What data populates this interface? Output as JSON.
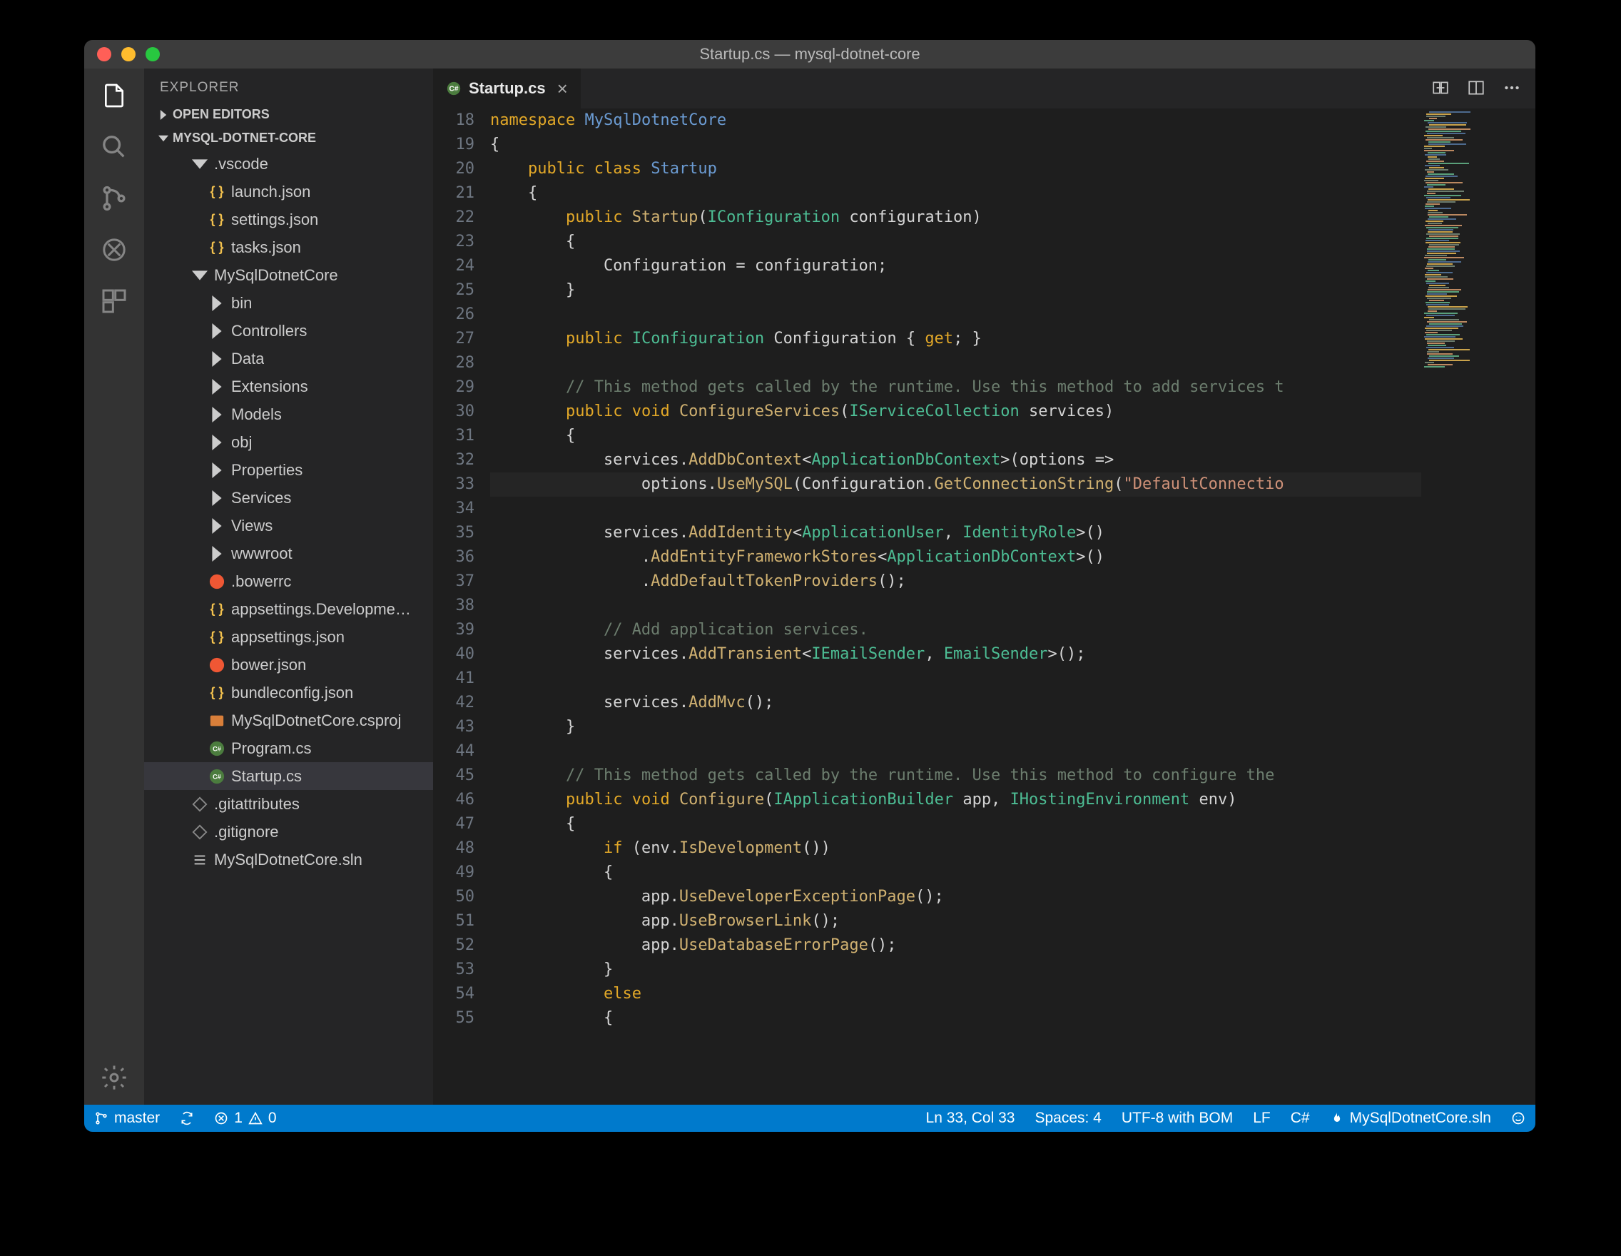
{
  "window": {
    "title": "Startup.cs — mysql-dotnet-core"
  },
  "sidebar": {
    "title": "EXPLORER",
    "open_editors": "OPEN EDITORS",
    "project": "MYSQL-DOTNET-CORE",
    "items": [
      {
        "label": ".vscode",
        "kind": "folder-open",
        "indent": 2
      },
      {
        "label": "launch.json",
        "kind": "json",
        "indent": 3
      },
      {
        "label": "settings.json",
        "kind": "json",
        "indent": 3
      },
      {
        "label": "tasks.json",
        "kind": "json",
        "indent": 3
      },
      {
        "label": "MySqlDotnetCore",
        "kind": "folder-open",
        "indent": 2
      },
      {
        "label": "bin",
        "kind": "folder",
        "indent": 3
      },
      {
        "label": "Controllers",
        "kind": "folder",
        "indent": 3
      },
      {
        "label": "Data",
        "kind": "folder",
        "indent": 3
      },
      {
        "label": "Extensions",
        "kind": "folder",
        "indent": 3
      },
      {
        "label": "Models",
        "kind": "folder",
        "indent": 3
      },
      {
        "label": "obj",
        "kind": "folder",
        "indent": 3
      },
      {
        "label": "Properties",
        "kind": "folder",
        "indent": 3
      },
      {
        "label": "Services",
        "kind": "folder",
        "indent": 3
      },
      {
        "label": "Views",
        "kind": "folder",
        "indent": 3
      },
      {
        "label": "wwwroot",
        "kind": "folder",
        "indent": 3
      },
      {
        "label": ".bowerrc",
        "kind": "bower",
        "indent": 3
      },
      {
        "label": "appsettings.Developme…",
        "kind": "json",
        "indent": 3
      },
      {
        "label": "appsettings.json",
        "kind": "json",
        "indent": 3
      },
      {
        "label": "bower.json",
        "kind": "bower",
        "indent": 3
      },
      {
        "label": "bundleconfig.json",
        "kind": "json",
        "indent": 3
      },
      {
        "label": "MySqlDotnetCore.csproj",
        "kind": "xml",
        "indent": 3
      },
      {
        "label": "Program.cs",
        "kind": "cs",
        "indent": 3
      },
      {
        "label": "Startup.cs",
        "kind": "cs",
        "indent": 3,
        "selected": true
      },
      {
        "label": ".gitattributes",
        "kind": "git",
        "indent": 2
      },
      {
        "label": ".gitignore",
        "kind": "git",
        "indent": 2
      },
      {
        "label": "MySqlDotnetCore.sln",
        "kind": "sln",
        "indent": 2
      }
    ]
  },
  "tab": {
    "label": "Startup.cs"
  },
  "gutter_start": 18,
  "code_lines": [
    [
      [
        "kw",
        "namespace"
      ],
      [
        "pun",
        " "
      ],
      [
        "type",
        "MySqlDotnetCore"
      ]
    ],
    [
      [
        "pun",
        "{"
      ]
    ],
    [
      [
        "pun",
        "    "
      ],
      [
        "kw",
        "public"
      ],
      [
        "pun",
        " "
      ],
      [
        "kw",
        "class"
      ],
      [
        "pun",
        " "
      ],
      [
        "type",
        "Startup"
      ]
    ],
    [
      [
        "pun",
        "    {"
      ]
    ],
    [
      [
        "pun",
        "        "
      ],
      [
        "kw",
        "public"
      ],
      [
        "pun",
        " "
      ],
      [
        "method",
        "Startup"
      ],
      [
        "pun",
        "("
      ],
      [
        "type2",
        "IConfiguration"
      ],
      [
        "pun",
        " configuration)"
      ]
    ],
    [
      [
        "pun",
        "        {"
      ]
    ],
    [
      [
        "pun",
        "            Configuration = configuration;"
      ]
    ],
    [
      [
        "pun",
        "        }"
      ]
    ],
    [
      [
        "pun",
        ""
      ]
    ],
    [
      [
        "pun",
        "        "
      ],
      [
        "kw",
        "public"
      ],
      [
        "pun",
        " "
      ],
      [
        "type2",
        "IConfiguration"
      ],
      [
        "pun",
        " Configuration { "
      ],
      [
        "kw",
        "get"
      ],
      [
        "pun",
        "; }"
      ]
    ],
    [
      [
        "pun",
        ""
      ]
    ],
    [
      [
        "pun",
        "        "
      ],
      [
        "comment",
        "// This method gets called by the runtime. Use this method to add services t"
      ]
    ],
    [
      [
        "pun",
        "        "
      ],
      [
        "kw",
        "public"
      ],
      [
        "pun",
        " "
      ],
      [
        "kw",
        "void"
      ],
      [
        "pun",
        " "
      ],
      [
        "method",
        "ConfigureServices"
      ],
      [
        "pun",
        "("
      ],
      [
        "type2",
        "IServiceCollection"
      ],
      [
        "pun",
        " services)"
      ]
    ],
    [
      [
        "pun",
        "        {"
      ]
    ],
    [
      [
        "pun",
        "            services."
      ],
      [
        "method",
        "AddDbContext"
      ],
      [
        "pun",
        "<"
      ],
      [
        "type2",
        "ApplicationDbContext"
      ],
      [
        "pun",
        ">(options =>"
      ]
    ],
    [
      [
        "pun",
        "                options."
      ],
      [
        "method",
        "UseMySQL"
      ],
      [
        "pun",
        "(Configuration."
      ],
      [
        "method",
        "GetConnectionString"
      ],
      [
        "pun",
        "("
      ],
      [
        "str",
        "\"DefaultConnectio"
      ]
    ],
    [
      [
        "pun",
        ""
      ]
    ],
    [
      [
        "pun",
        "            services."
      ],
      [
        "method",
        "AddIdentity"
      ],
      [
        "pun",
        "<"
      ],
      [
        "type2",
        "ApplicationUser"
      ],
      [
        "pun",
        ", "
      ],
      [
        "type2",
        "IdentityRole"
      ],
      [
        "pun",
        ">()"
      ]
    ],
    [
      [
        "pun",
        "                ."
      ],
      [
        "method",
        "AddEntityFrameworkStores"
      ],
      [
        "pun",
        "<"
      ],
      [
        "type2",
        "ApplicationDbContext"
      ],
      [
        "pun",
        ">()"
      ]
    ],
    [
      [
        "pun",
        "                ."
      ],
      [
        "method",
        "AddDefaultTokenProviders"
      ],
      [
        "pun",
        "();"
      ]
    ],
    [
      [
        "pun",
        ""
      ]
    ],
    [
      [
        "pun",
        "            "
      ],
      [
        "comment",
        "// Add application services."
      ]
    ],
    [
      [
        "pun",
        "            services."
      ],
      [
        "method",
        "AddTransient"
      ],
      [
        "pun",
        "<"
      ],
      [
        "type2",
        "IEmailSender"
      ],
      [
        "pun",
        ", "
      ],
      [
        "type2",
        "EmailSender"
      ],
      [
        "pun",
        ">();"
      ]
    ],
    [
      [
        "pun",
        ""
      ]
    ],
    [
      [
        "pun",
        "            services."
      ],
      [
        "method",
        "AddMvc"
      ],
      [
        "pun",
        "();"
      ]
    ],
    [
      [
        "pun",
        "        }"
      ]
    ],
    [
      [
        "pun",
        ""
      ]
    ],
    [
      [
        "pun",
        "        "
      ],
      [
        "comment",
        "// This method gets called by the runtime. Use this method to configure the "
      ]
    ],
    [
      [
        "pun",
        "        "
      ],
      [
        "kw",
        "public"
      ],
      [
        "pun",
        " "
      ],
      [
        "kw",
        "void"
      ],
      [
        "pun",
        " "
      ],
      [
        "method",
        "Configure"
      ],
      [
        "pun",
        "("
      ],
      [
        "type2",
        "IApplicationBuilder"
      ],
      [
        "pun",
        " app, "
      ],
      [
        "type2",
        "IHostingEnvironment"
      ],
      [
        "pun",
        " env)"
      ]
    ],
    [
      [
        "pun",
        "        {"
      ]
    ],
    [
      [
        "pun",
        "            "
      ],
      [
        "kw",
        "if"
      ],
      [
        "pun",
        " (env."
      ],
      [
        "method",
        "IsDevelopment"
      ],
      [
        "pun",
        "())"
      ]
    ],
    [
      [
        "pun",
        "            {"
      ]
    ],
    [
      [
        "pun",
        "                app."
      ],
      [
        "method",
        "UseDeveloperExceptionPage"
      ],
      [
        "pun",
        "();"
      ]
    ],
    [
      [
        "pun",
        "                app."
      ],
      [
        "method",
        "UseBrowserLink"
      ],
      [
        "pun",
        "();"
      ]
    ],
    [
      [
        "pun",
        "                app."
      ],
      [
        "method",
        "UseDatabaseErrorPage"
      ],
      [
        "pun",
        "();"
      ]
    ],
    [
      [
        "pun",
        "            }"
      ]
    ],
    [
      [
        "pun",
        "            "
      ],
      [
        "kw",
        "else"
      ]
    ],
    [
      [
        "pun",
        "            {"
      ]
    ]
  ],
  "status": {
    "branch": "master",
    "errors": "1",
    "warnings": "0",
    "lncol": "Ln 33, Col 33",
    "spaces": "Spaces: 4",
    "encoding": "UTF-8 with BOM",
    "eol": "LF",
    "lang": "C#",
    "sln": "MySqlDotnetCore.sln"
  }
}
